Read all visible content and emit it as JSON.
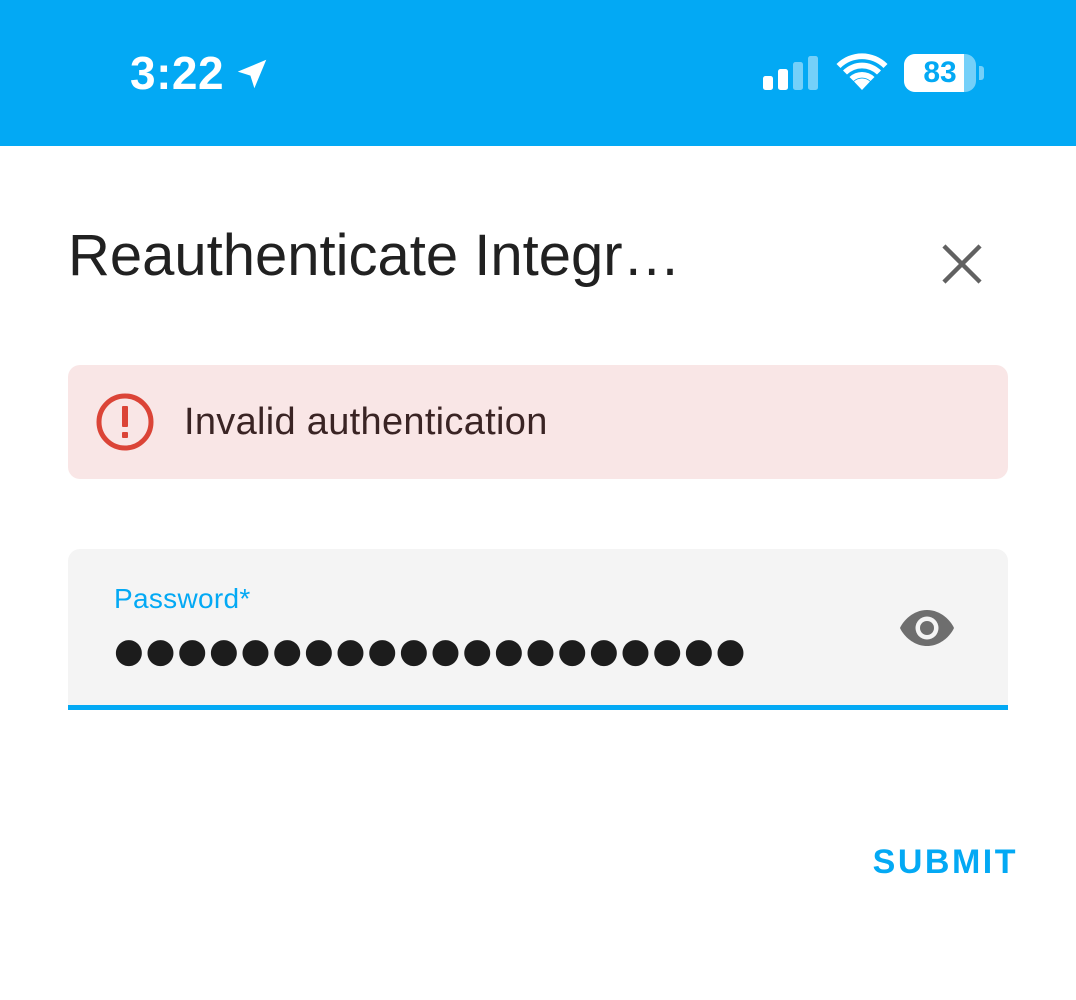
{
  "status_bar": {
    "time": "3:22",
    "battery_level": 83,
    "battery_label": "83",
    "signal_bars_active": 2,
    "signal_bars_total": 4,
    "background_color": "#03a9f4"
  },
  "dialog": {
    "title": "Reauthenticate Integr…",
    "close_icon": "close-icon"
  },
  "alert": {
    "icon": "error-icon",
    "message": "Invalid authentication",
    "background_color": "#f9e6e6",
    "icon_color": "#db4437"
  },
  "password_field": {
    "label": "Password*",
    "value": "●●●●●●●●●●●●●●●●●●●●",
    "toggle_icon": "eye-icon"
  },
  "actions": {
    "submit_label": "SUBMIT"
  },
  "colors": {
    "accent": "#03a9f4",
    "text_primary": "#212121",
    "field_background": "#f4f4f4"
  }
}
